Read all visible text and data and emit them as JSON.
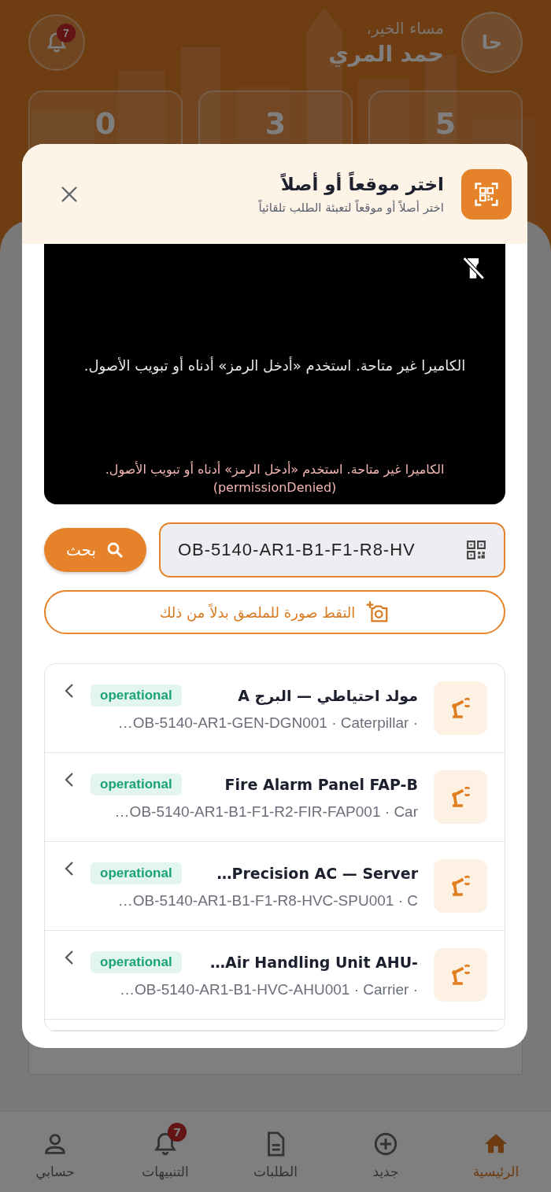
{
  "header": {
    "avatar": "حا",
    "greeting": "مساء الخير،",
    "name": "حمد المري",
    "badge": "7"
  },
  "stats": [
    {
      "value": "5"
    },
    {
      "value": "3"
    },
    {
      "value": "0"
    }
  ],
  "modal": {
    "title": "اختر موقعاً أو أصلاً",
    "subtitle": "اختر أصلاً أو موقعاً لتعبئة الطلب تلقائياً",
    "camera": {
      "message": "الكاميرا غير متاحة. استخدم «أدخل الرمز» أدناه أو تبويب الأصول.",
      "error": "الكاميرا غير متاحة. استخدم «أدخل الرمز» أدناه أو تبويب الأصول.",
      "error_code": "(permissionDenied)"
    },
    "search": {
      "value": "OB-5140-AR1-B1-F1-R8-HV",
      "button": "بحث"
    },
    "photo_button": "التقط صورة للملصق بدلاً من ذلك",
    "assets": [
      {
        "title": "مولد احتياطي — البرج A",
        "subtitle": "…OB-5140-AR1-GEN-DGN001 · Caterpillar ·",
        "status": "operational"
      },
      {
        "title": "Fire Alarm Panel FAP-B",
        "subtitle": "…OB-5140-AR1-B1-F1-R2-FIR-FAP001 · Car",
        "status": "operational"
      },
      {
        "title": "…Precision AC — Server",
        "subtitle": "…OB-5140-AR1-B1-F1-R8-HVC-SPU001 · C",
        "status": "operational"
      },
      {
        "title": "…Air Handling Unit AHU-",
        "subtitle": "…OB-5140-AR1-B1-HVC-AHU001 · Carrier ·",
        "status": "operational"
      }
    ]
  },
  "nav": [
    {
      "label": "الرئيسية",
      "kind": "home",
      "selected": true
    },
    {
      "label": "جديد",
      "kind": "add",
      "selected": false
    },
    {
      "label": "الطلبات",
      "kind": "document",
      "selected": false
    },
    {
      "label": "التنبيهات",
      "kind": "bell",
      "selected": false,
      "badge": "7"
    },
    {
      "label": "حسابي",
      "kind": "person",
      "selected": false
    }
  ]
}
